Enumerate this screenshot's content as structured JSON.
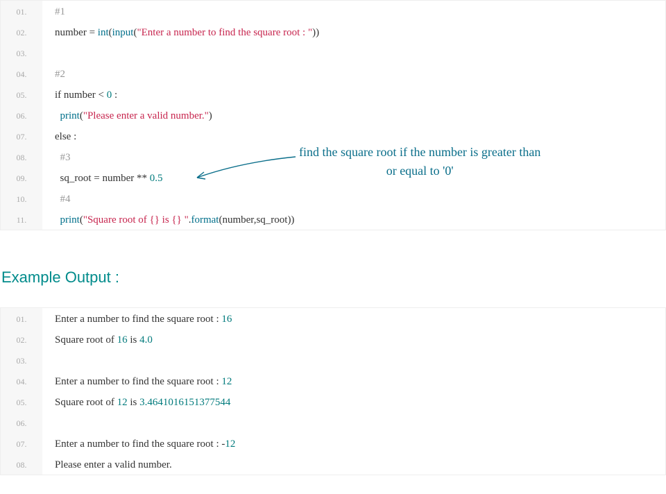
{
  "code1": {
    "lines": [
      {
        "n": "01.",
        "tokens": [
          {
            "cls": "tok-comment",
            "t": "#1"
          }
        ]
      },
      {
        "n": "02.",
        "tokens": [
          {
            "cls": "tok-ident",
            "t": "number "
          },
          {
            "cls": "tok-op",
            "t": "="
          },
          {
            "cls": "tok-ident",
            "t": " "
          },
          {
            "cls": "tok-func",
            "t": "int"
          },
          {
            "cls": "tok-op",
            "t": "("
          },
          {
            "cls": "tok-func",
            "t": "input"
          },
          {
            "cls": "tok-op",
            "t": "("
          },
          {
            "cls": "tok-string",
            "t": "\"Enter a number to find the square root : \""
          },
          {
            "cls": "tok-op",
            "t": "))"
          }
        ]
      },
      {
        "n": "03.",
        "tokens": []
      },
      {
        "n": "04.",
        "tokens": [
          {
            "cls": "tok-comment",
            "t": "#2"
          }
        ]
      },
      {
        "n": "05.",
        "tokens": [
          {
            "cls": "tok-keyword",
            "t": "if"
          },
          {
            "cls": "tok-ident",
            "t": " number "
          },
          {
            "cls": "tok-op",
            "t": "<"
          },
          {
            "cls": "tok-ident",
            "t": " "
          },
          {
            "cls": "tok-number",
            "t": "0"
          },
          {
            "cls": "tok-ident",
            "t": " "
          },
          {
            "cls": "tok-op",
            "t": ":"
          }
        ]
      },
      {
        "n": "06.",
        "tokens": [
          {
            "cls": "tok-ident",
            "t": "  "
          },
          {
            "cls": "tok-func",
            "t": "print"
          },
          {
            "cls": "tok-op",
            "t": "("
          },
          {
            "cls": "tok-string",
            "t": "\"Please enter a valid number.\""
          },
          {
            "cls": "tok-op",
            "t": ")"
          }
        ]
      },
      {
        "n": "07.",
        "tokens": [
          {
            "cls": "tok-keyword",
            "t": "else"
          },
          {
            "cls": "tok-ident",
            "t": " "
          },
          {
            "cls": "tok-op",
            "t": ":"
          }
        ]
      },
      {
        "n": "08.",
        "tokens": [
          {
            "cls": "tok-ident",
            "t": "  "
          },
          {
            "cls": "tok-comment",
            "t": "#3"
          }
        ]
      },
      {
        "n": "09.",
        "tokens": [
          {
            "cls": "tok-ident",
            "t": "  sq_root "
          },
          {
            "cls": "tok-op",
            "t": "="
          },
          {
            "cls": "tok-ident",
            "t": " number "
          },
          {
            "cls": "tok-op",
            "t": "**"
          },
          {
            "cls": "tok-ident",
            "t": " "
          },
          {
            "cls": "tok-number",
            "t": "0.5"
          }
        ]
      },
      {
        "n": "10.",
        "tokens": [
          {
            "cls": "tok-ident",
            "t": "  "
          },
          {
            "cls": "tok-comment",
            "t": "#4"
          }
        ]
      },
      {
        "n": "11.",
        "tokens": [
          {
            "cls": "tok-ident",
            "t": "  "
          },
          {
            "cls": "tok-func",
            "t": "print"
          },
          {
            "cls": "tok-op",
            "t": "("
          },
          {
            "cls": "tok-string",
            "t": "\"Square root of {} is {} \""
          },
          {
            "cls": "tok-op",
            "t": "."
          },
          {
            "cls": "tok-func",
            "t": "format"
          },
          {
            "cls": "tok-op",
            "t": "("
          },
          {
            "cls": "tok-ident",
            "t": "number"
          },
          {
            "cls": "tok-op",
            "t": ","
          },
          {
            "cls": "tok-ident",
            "t": "sq_root"
          },
          {
            "cls": "tok-op",
            "t": "))"
          }
        ]
      }
    ]
  },
  "annotation": {
    "line1": "find the square root if the number is greater than",
    "line2": "or equal to '0'"
  },
  "heading": "Example Output :",
  "code2": {
    "lines": [
      {
        "n": "01.",
        "tokens": [
          {
            "cls": "tok-ident",
            "t": "Enter a number to find the square root "
          },
          {
            "cls": "tok-op",
            "t": ":"
          },
          {
            "cls": "tok-ident",
            "t": " "
          },
          {
            "cls": "tok-number",
            "t": "16"
          }
        ]
      },
      {
        "n": "02.",
        "tokens": [
          {
            "cls": "tok-ident",
            "t": "Square root of "
          },
          {
            "cls": "tok-number",
            "t": "16"
          },
          {
            "cls": "tok-ident",
            "t": " is "
          },
          {
            "cls": "tok-number",
            "t": "4.0"
          }
        ]
      },
      {
        "n": "03.",
        "tokens": []
      },
      {
        "n": "04.",
        "tokens": [
          {
            "cls": "tok-ident",
            "t": "Enter a number to find the square root "
          },
          {
            "cls": "tok-op",
            "t": ":"
          },
          {
            "cls": "tok-ident",
            "t": " "
          },
          {
            "cls": "tok-number",
            "t": "12"
          }
        ]
      },
      {
        "n": "05.",
        "tokens": [
          {
            "cls": "tok-ident",
            "t": "Square root of "
          },
          {
            "cls": "tok-number",
            "t": "12"
          },
          {
            "cls": "tok-ident",
            "t": " is "
          },
          {
            "cls": "tok-number",
            "t": "3.4641016151377544"
          }
        ]
      },
      {
        "n": "06.",
        "tokens": []
      },
      {
        "n": "07.",
        "tokens": [
          {
            "cls": "tok-ident",
            "t": "Enter a number to find the square root "
          },
          {
            "cls": "tok-op",
            "t": ":"
          },
          {
            "cls": "tok-ident",
            "t": " "
          },
          {
            "cls": "tok-op",
            "t": "-"
          },
          {
            "cls": "tok-number",
            "t": "12"
          }
        ]
      },
      {
        "n": "08.",
        "tokens": [
          {
            "cls": "tok-ident",
            "t": "Please enter a valid number"
          },
          {
            "cls": "tok-op",
            "t": "."
          }
        ]
      }
    ]
  }
}
